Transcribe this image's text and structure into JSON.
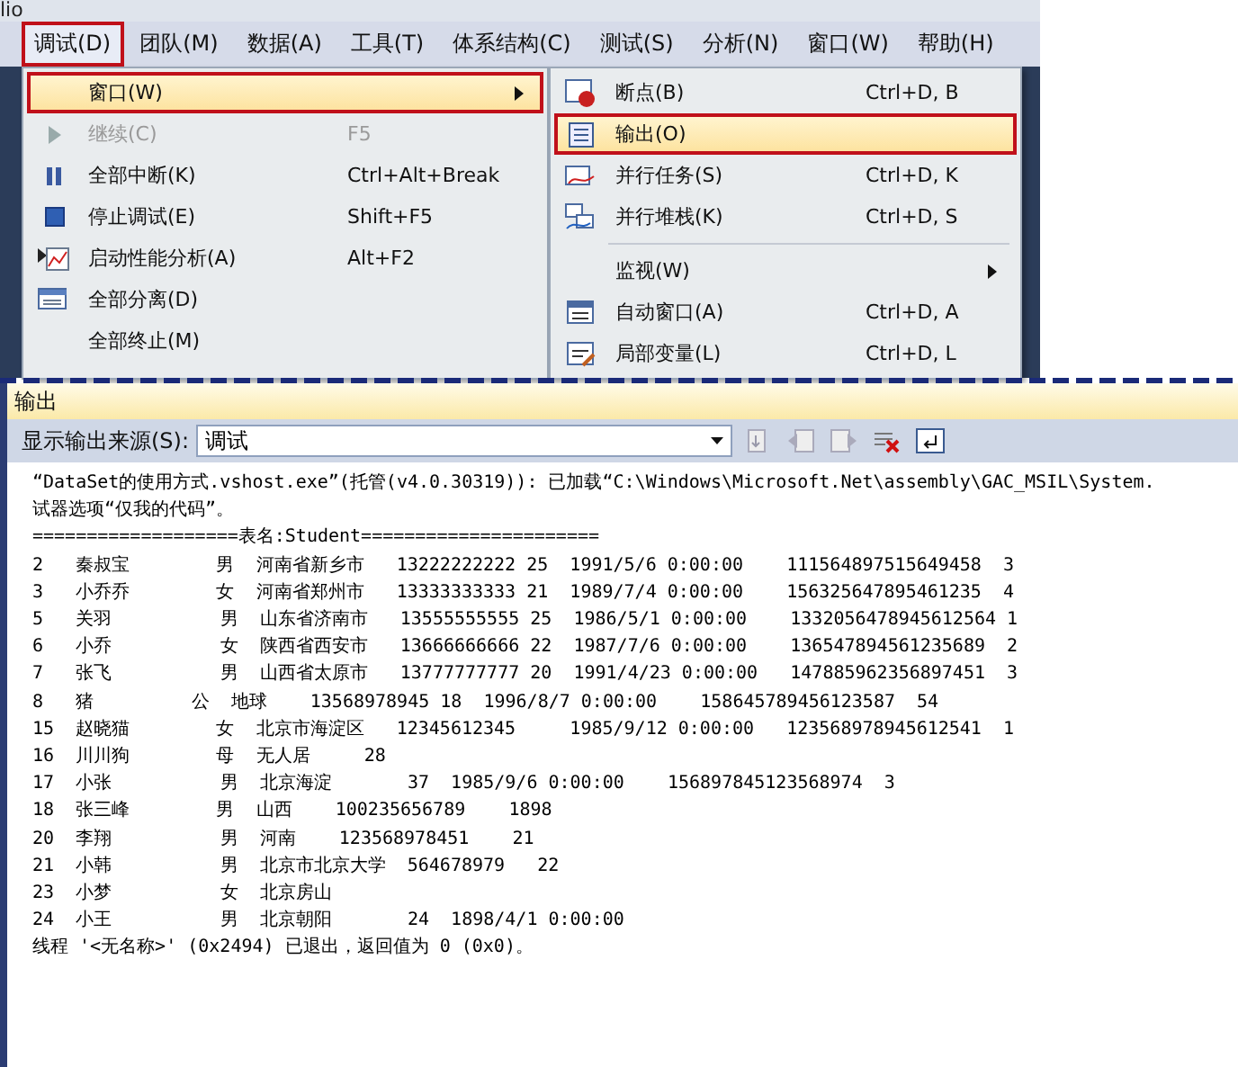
{
  "app_title": "lio",
  "menubar": [
    {
      "label": "调试(D)",
      "selected": true,
      "annotated": true
    },
    {
      "label": "团队(M)",
      "selected": false,
      "annotated": false
    },
    {
      "label": "数据(A)",
      "selected": false,
      "annotated": false
    },
    {
      "label": "工具(T)",
      "selected": false,
      "annotated": false
    },
    {
      "label": "体系结构(C)",
      "selected": false,
      "annotated": false
    },
    {
      "label": "测试(S)",
      "selected": false,
      "annotated": false
    },
    {
      "label": "分析(N)",
      "selected": false,
      "annotated": false
    },
    {
      "label": "窗口(W)",
      "selected": false,
      "annotated": false
    },
    {
      "label": "帮助(H)",
      "selected": false,
      "annotated": false
    }
  ],
  "debug_menu": [
    {
      "kind": "item",
      "label": "窗口(W)",
      "submenu": true,
      "selected": true,
      "annotated": true,
      "disabled": false
    },
    {
      "kind": "item",
      "label": "继续(C)",
      "shortcut": "F5",
      "submenu": false,
      "selected": false,
      "annotated": false,
      "disabled": true
    },
    {
      "kind": "item",
      "label": "全部中断(K)",
      "shortcut": "Ctrl+Alt+Break",
      "submenu": false,
      "selected": false,
      "annotated": false,
      "disabled": false
    },
    {
      "kind": "item",
      "label": "停止调试(E)",
      "shortcut": "Shift+F5",
      "submenu": false,
      "selected": false,
      "annotated": false,
      "disabled": false
    },
    {
      "kind": "item",
      "label": "启动性能分析(A)",
      "shortcut": "Alt+F2",
      "submenu": false,
      "selected": false,
      "annotated": false,
      "disabled": false
    },
    {
      "kind": "item",
      "label": "全部分离(D)",
      "submenu": false,
      "selected": false,
      "annotated": false,
      "disabled": false
    },
    {
      "kind": "item",
      "label": "全部终止(M)",
      "submenu": false,
      "selected": false,
      "annotated": false,
      "disabled": false
    }
  ],
  "window_submenu": [
    {
      "kind": "item",
      "label": "断点(B)",
      "shortcut": "Ctrl+D, B",
      "submenu": false,
      "selected": false,
      "annotated": false,
      "disabled": false
    },
    {
      "kind": "item",
      "label": "输出(O)",
      "submenu": false,
      "selected": true,
      "annotated": true,
      "disabled": false
    },
    {
      "kind": "item",
      "label": "并行任务(S)",
      "shortcut": "Ctrl+D, K",
      "submenu": false,
      "selected": false,
      "annotated": false,
      "disabled": false
    },
    {
      "kind": "item",
      "label": "并行堆栈(K)",
      "shortcut": "Ctrl+D, S",
      "submenu": false,
      "selected": false,
      "annotated": false,
      "disabled": false
    },
    {
      "kind": "separator"
    },
    {
      "kind": "item",
      "label": "监视(W)",
      "submenu": true,
      "selected": false,
      "annotated": false,
      "disabled": false
    },
    {
      "kind": "item",
      "label": "自动窗口(A)",
      "shortcut": "Ctrl+D, A",
      "submenu": false,
      "selected": false,
      "annotated": false,
      "disabled": false
    },
    {
      "kind": "item",
      "label": "局部变量(L)",
      "shortcut": "Ctrl+D, L",
      "submenu": false,
      "selected": false,
      "annotated": false,
      "disabled": false
    }
  ],
  "output_panel": {
    "title": "输出",
    "source_label": "显示输出来源(S):",
    "source_value": "调试",
    "lines": [
      "“DataSet的使用方式.vshost.exe”(托管(v4.0.30319)): 已加载“C:\\Windows\\Microsoft.Net\\assembly\\GAC_MSIL\\System.",
      "试器选项“仅我的代码”。",
      "===================表名:Student======================",
      "2   秦叔宝        男  河南省新乡市   13222222222 25  1991/5/6 0:00:00    111564897515649458  3",
      "3   小乔乔        女  河南省郑州市   13333333333 21  1989/7/4 0:00:00    156325647895461235  4",
      "5   关羽          男  山东省济南市   13555555555 25  1986/5/1 0:00:00    1332056478945612564 1",
      "6   小乔          女  陕西省西安市   13666666666 22  1987/7/6 0:00:00    136547894561235689  2",
      "7   张飞          男  山西省太原市   13777777777 20  1991/4/23 0:00:00   147885962356897451  3",
      "8   猪         公  地球    13568978945 18  1996/8/7 0:00:00    158645789456123587  54",
      "15  赵晓猫        女  北京市海淀区   12345612345     1985/9/12 0:00:00   123568978945612541  1",
      "16  川川狗        母  无人居     28",
      "17  小张          男  北京海淀       37  1985/9/6 0:00:00    156897845123568974  3",
      "18  张三峰        男  山西    100235656789    1898",
      "20  李翔          男  河南    123568978451    21",
      "21  小韩          男  北京市北京大学  564678979   22",
      "23  小梦          女  北京房山",
      "24  小王          男  北京朝阳       24  1898/4/1 0:00:00",
      "线程 '<无名称>' (0x2494) 已退出，返回值为 0 (0x0)。"
    ]
  }
}
